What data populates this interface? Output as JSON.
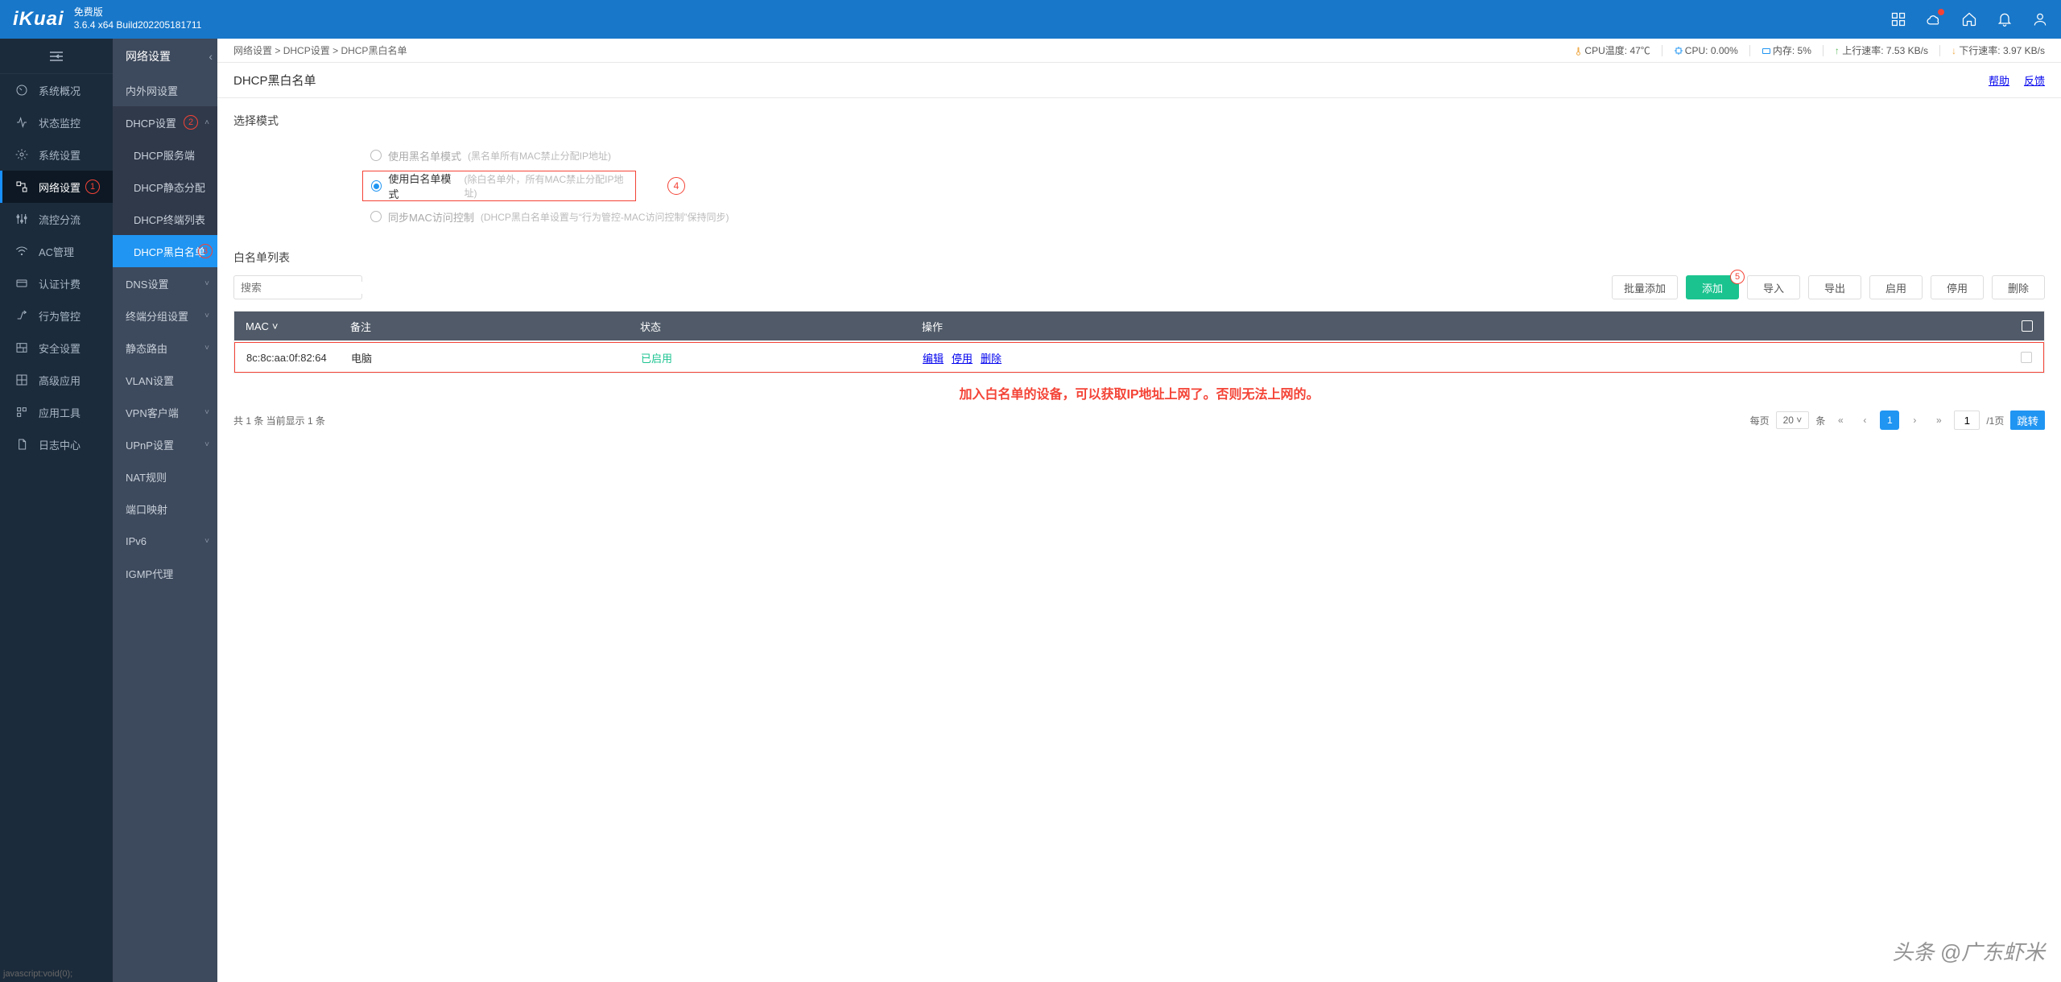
{
  "header": {
    "logo": "iKuai",
    "edition": "免费版",
    "version": "3.6.4 x64 Build202205181711"
  },
  "status": {
    "cpu_temp_label": "CPU温度:",
    "cpu_temp_value": "47℃",
    "cpu_label": "CPU:",
    "cpu_value": "0.00%",
    "mem_label": "内存:",
    "mem_value": "5%",
    "up_label": "上行速率:",
    "up_value": "7.53 KB/s",
    "down_label": "下行速率:",
    "down_value": "3.97 KB/s"
  },
  "breadcrumb": {
    "a": "网络设置",
    "b": "DHCP设置",
    "c": "DHCP黑白名单",
    "sep": ">"
  },
  "page": {
    "title": "DHCP黑白名单",
    "help": "帮助",
    "feedback": "反馈"
  },
  "sidebar1": {
    "items": [
      {
        "label": "系统概况"
      },
      {
        "label": "状态监控"
      },
      {
        "label": "系统设置"
      },
      {
        "label": "网络设置",
        "active": true,
        "badge": "1"
      },
      {
        "label": "流控分流"
      },
      {
        "label": "AC管理"
      },
      {
        "label": "认证计费"
      },
      {
        "label": "行为管控"
      },
      {
        "label": "安全设置"
      },
      {
        "label": "高级应用"
      },
      {
        "label": "应用工具"
      },
      {
        "label": "日志中心"
      }
    ]
  },
  "sidebar2": {
    "title": "网络设置",
    "items": [
      {
        "label": "内外网设置"
      },
      {
        "label": "DHCP设置",
        "expand": true,
        "badge": "2",
        "subs": [
          {
            "label": "DHCP服务端"
          },
          {
            "label": "DHCP静态分配"
          },
          {
            "label": "DHCP终端列表"
          },
          {
            "label": "DHCP黑白名单",
            "active": true,
            "badge": "3"
          }
        ]
      },
      {
        "label": "DNS设置",
        "expand": false,
        "chev": true
      },
      {
        "label": "终端分组设置",
        "expand": false,
        "chev": true
      },
      {
        "label": "静态路由",
        "expand": false,
        "chev": true
      },
      {
        "label": "VLAN设置"
      },
      {
        "label": "VPN客户端",
        "expand": false,
        "chev": true
      },
      {
        "label": "UPnP设置",
        "expand": false,
        "chev": true
      },
      {
        "label": "NAT规则"
      },
      {
        "label": "端口映射"
      },
      {
        "label": "IPv6",
        "expand": false,
        "chev": true
      },
      {
        "label": "IGMP代理"
      }
    ]
  },
  "mode": {
    "section_title": "选择模式",
    "row1": {
      "label": "使用黑名单模式",
      "hint": "(黑名单所有MAC禁止分配IP地址)"
    },
    "row2": {
      "label": "使用白名单模式",
      "hint": "(除白名单外，所有MAC禁止分配IP地址)",
      "badge": "4"
    },
    "row3": {
      "label": "同步MAC访问控制",
      "hint": "(DHCP黑白名单设置与“行为管控-MAC访问控制”保持同步)"
    }
  },
  "list": {
    "title": "白名单列表",
    "search_placeholder": "搜索",
    "buttons": {
      "batch_add": "批量添加",
      "add": "添加",
      "add_badge": "5",
      "import": "导入",
      "export": "导出",
      "enable": "启用",
      "disable": "停用",
      "delete": "删除"
    },
    "columns": {
      "mac": "MAC",
      "note": "备注",
      "status": "状态",
      "ops": "操作"
    },
    "rows": [
      {
        "mac": "8c:8c:aa:0f:82:64",
        "note": "电脑",
        "status": "已启用",
        "ops": [
          "编辑",
          "停用",
          "删除"
        ]
      }
    ],
    "annotation": "加入白名单的设备，可以获取IP地址上网了。否则无法上网的。",
    "footer": {
      "total": "共 1 条 当前显示 1 条",
      "per_page_label": "每页",
      "per_page_value": "20",
      "unit": "条",
      "page_current": "1",
      "page_input": "1",
      "page_total": "/1页",
      "jump": "跳转"
    }
  },
  "watermark": "头条 @广东虾米",
  "js_hint": "javascript:void(0);"
}
